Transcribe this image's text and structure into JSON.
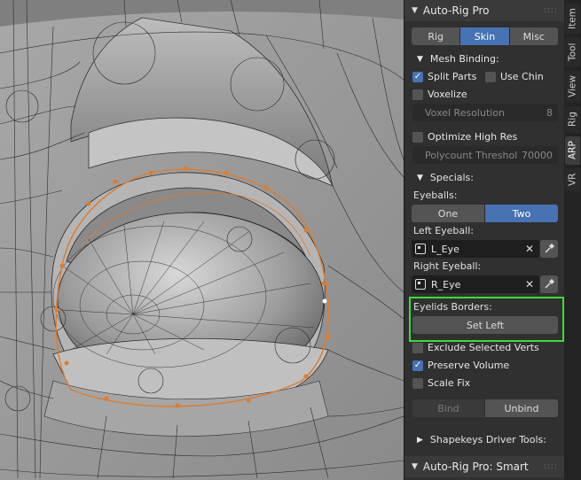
{
  "panel": {
    "title": "Auto-Rig Pro",
    "tabs": [
      {
        "label": "Rig",
        "active": false
      },
      {
        "label": "Skin",
        "active": true
      },
      {
        "label": "Misc",
        "active": false
      }
    ],
    "mesh_binding": {
      "label": "Mesh Binding:",
      "split_parts": {
        "label": "Split Parts",
        "checked": true
      },
      "use_chin": {
        "label": "Use Chin",
        "checked": false
      },
      "voxelize": {
        "label": "Voxelize",
        "checked": false
      },
      "voxel_resolution": {
        "label": "Voxel Resolution",
        "value": "8"
      },
      "optimize_high_res": {
        "label": "Optimize High Res",
        "checked": false
      },
      "polycount_threshold": {
        "label": "Polycount Threshol",
        "value": "70000"
      }
    },
    "specials": {
      "label": "Specials:",
      "eyeballs_label": "Eyeballs:",
      "eyeball_options": [
        {
          "label": "One",
          "active": false
        },
        {
          "label": "Two",
          "active": true
        }
      ],
      "left_eyeball_label": "Left Eyeball:",
      "left_eyeball_value": "L_Eye",
      "right_eyeball_label": "Right Eyeball:",
      "right_eyeball_value": "R_Eye",
      "eyelids_borders_label": "Eyelids Borders:",
      "set_left_button": "Set Left",
      "exclude_selected": {
        "label": "Exclude Selected Verts",
        "checked": false
      },
      "preserve_volume": {
        "label": "Preserve Volume",
        "checked": true
      },
      "scale_fix": {
        "label": "Scale Fix",
        "checked": false
      }
    },
    "bind_button": "Bind",
    "unbind_button": "Unbind",
    "shapekeys_label": "Shapekeys Driver Tools:",
    "smart_title": "Auto-Rig Pro: Smart"
  },
  "side_tabs": [
    {
      "label": "Item",
      "active": false
    },
    {
      "label": "Tool",
      "active": false
    },
    {
      "label": "View",
      "active": false
    },
    {
      "label": "Rig",
      "active": false
    },
    {
      "label": "ARP",
      "active": true
    },
    {
      "label": "VR",
      "active": false
    }
  ],
  "colors": {
    "accent": "#4772b3",
    "highlight_box": "#3bdc3b",
    "selected_edges": "#e07b2a",
    "mesh_shading": "#9a9a9a"
  }
}
